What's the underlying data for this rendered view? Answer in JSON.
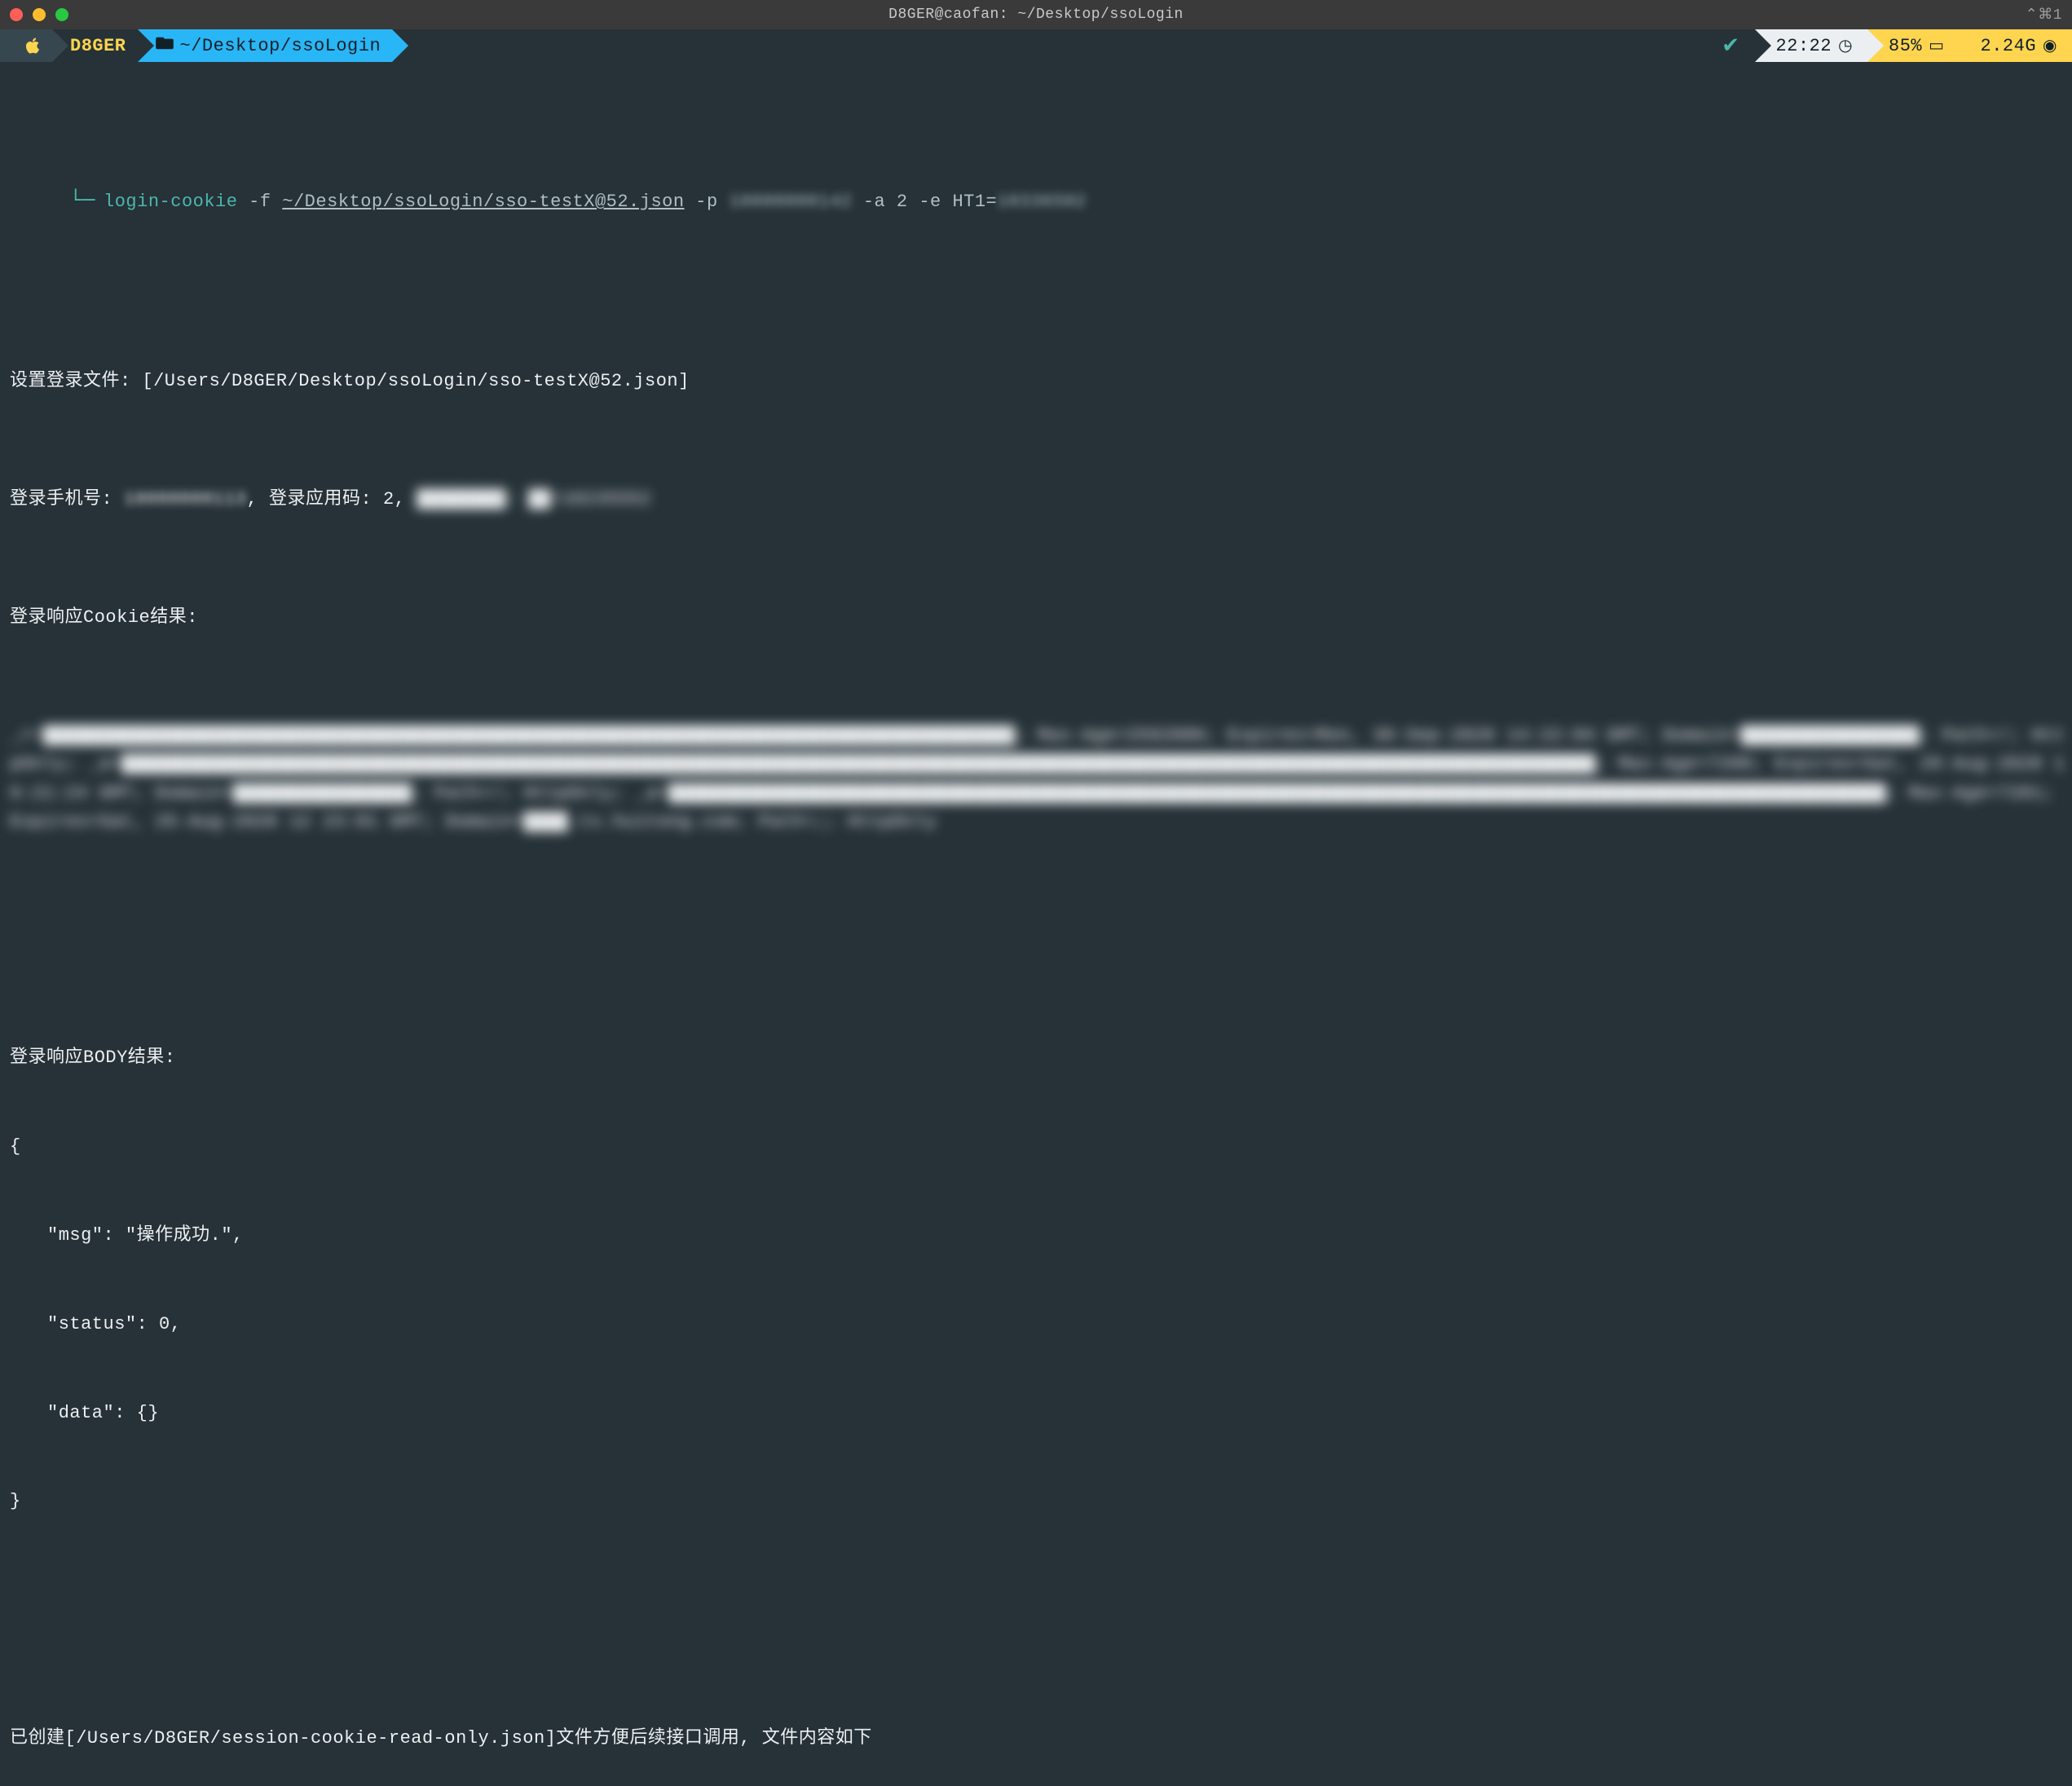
{
  "window": {
    "title": "D8GER@caofan: ~/Desktop/ssoLogin",
    "right_indicator": "⌃⌘1"
  },
  "prompt": {
    "user": "D8GER",
    "path_prefix_icon": "folder",
    "path": "~/Desktop/ssoLogin"
  },
  "status": {
    "check": "✔",
    "time": "22:22",
    "clock_icon": "◷",
    "battery_pct": "85%",
    "battery_icon": "▭",
    "memory": "2.24G",
    "gauge_icon": "◉"
  },
  "command": {
    "prompt_glyph": "└─",
    "name": "login-cookie",
    "flag_f": "-f",
    "arg_f": "~/Desktop/ssoLogin/sso-testX@52.json",
    "flag_p": "-p",
    "arg_p": "18000000142",
    "flag_a": "-a",
    "arg_a": "2",
    "flag_e": "-e",
    "arg_e": "HT1=10336502"
  },
  "output": {
    "l1_label": "设置登录文件: ",
    "l1_value": "[/Users/D8GER/Desktop/ssoLogin/sso-testX@52.json]",
    "l2_a": "登录手机号: ",
    "l2_phone": "18000000113",
    "l2_b": ", 登录应用码: 2, ",
    "l2_redacted": "████████: ██=10235552",
    "l3": "登录响应Cookie结果: ",
    "cookie_text": "_r=███████████████████████████████████████████████████████████████████████████████████████; Max-Age=2592000; Expires=Mon, 30-Sep-2020 14:22:04 GMT; Domain=████████████████; Path=/; HttpOnly; _a=████████████████████████████████████████████████████████████████████████████████████████████████████████████████████████████████████; Max-Age=7200; Expires=Sat, 29-Aug-2020 16:21:24 GMT; Domain=████████████████; Path=/; HttpOnly; _a=█████████████████████████████████████████████████████████████████████████████████████████████████████████████; Max-Age=7201; Expires=Sat, 25-Aug-2020 12 23:01 GMT; Domain=████.tx.huitong.com; Path=;; HttpOnly",
    "body_label": "登录响应BODY结果: ",
    "json_open": "{",
    "json_msg": "\"msg\": \"操作成功.\",",
    "json_status": "\"status\": 0,",
    "json_data": "\"data\": {}",
    "json_close": "}",
    "created_a": "已创建[",
    "created_path": "/Users/D8GER/session-cookie-read-only.json",
    "created_b": "]文件方便后续接口调用, 文件内容如下"
  }
}
